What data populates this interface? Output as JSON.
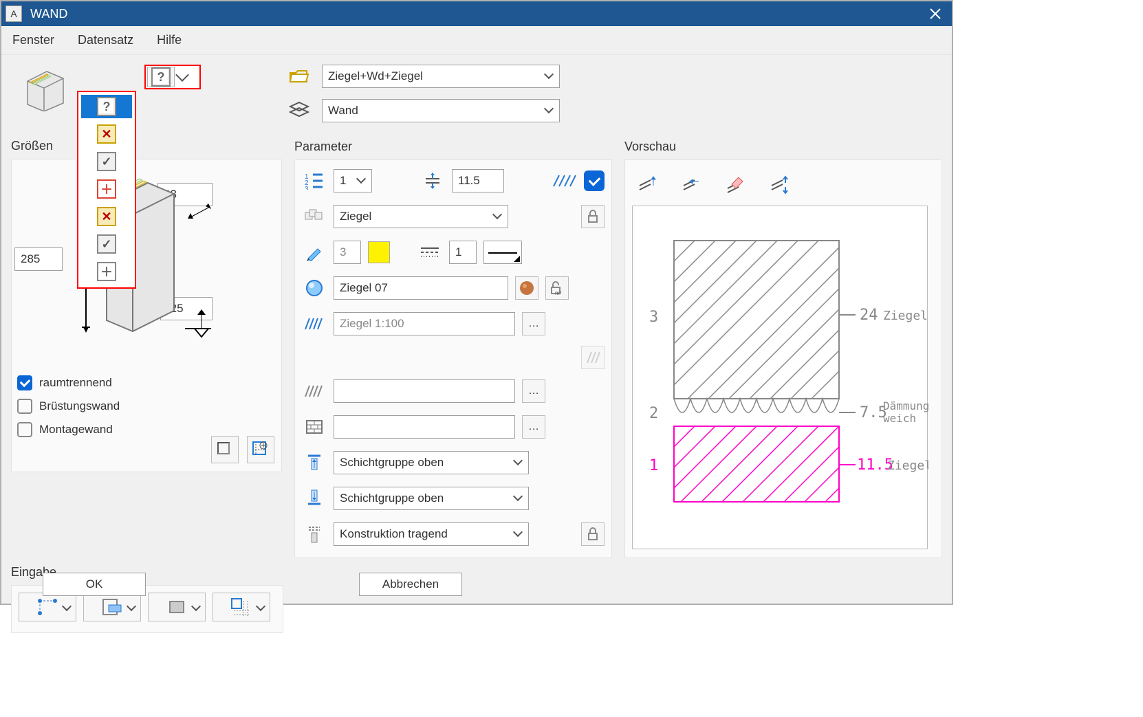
{
  "title": "WAND",
  "menu": {
    "items": [
      "Fenster",
      "Datensatz",
      "Hilfe"
    ]
  },
  "favorite": {
    "value": "Ziegel+Wd+Ziegel"
  },
  "layer": {
    "value": "Wand"
  },
  "sizes": {
    "heading": "Größen",
    "height": "285",
    "top": "43",
    "bottom": "-25"
  },
  "options": {
    "room_separating": {
      "label": "raumtrennend",
      "checked": true
    },
    "parapet": {
      "label": "Brüstungswand",
      "checked": false
    },
    "mounting": {
      "label": "Montagewand",
      "checked": false
    }
  },
  "eingabe": {
    "heading": "Eingabe"
  },
  "parameter": {
    "heading": "Parameter",
    "layer_num": "1",
    "thickness": "11.5",
    "material": "Ziegel",
    "pen": "3",
    "line_width": "1",
    "surface": "Ziegel 07",
    "hatch1_100": "Ziegel 1:100",
    "group_top": "Schichtgruppe oben",
    "group_bottom": "Schichtgruppe oben",
    "construction": "Konstruktion tragend"
  },
  "preview": {
    "heading": "Vorschau",
    "rows": [
      {
        "num": "3",
        "thick": "24",
        "mat": "Ziegel"
      },
      {
        "num": "2",
        "thick": "7.5",
        "mat": "Dämmung weich"
      },
      {
        "num": "1",
        "thick": "11.5",
        "mat": "Ziegel"
      }
    ]
  },
  "buttons": {
    "ok": "OK",
    "cancel": "Abbrechen"
  }
}
